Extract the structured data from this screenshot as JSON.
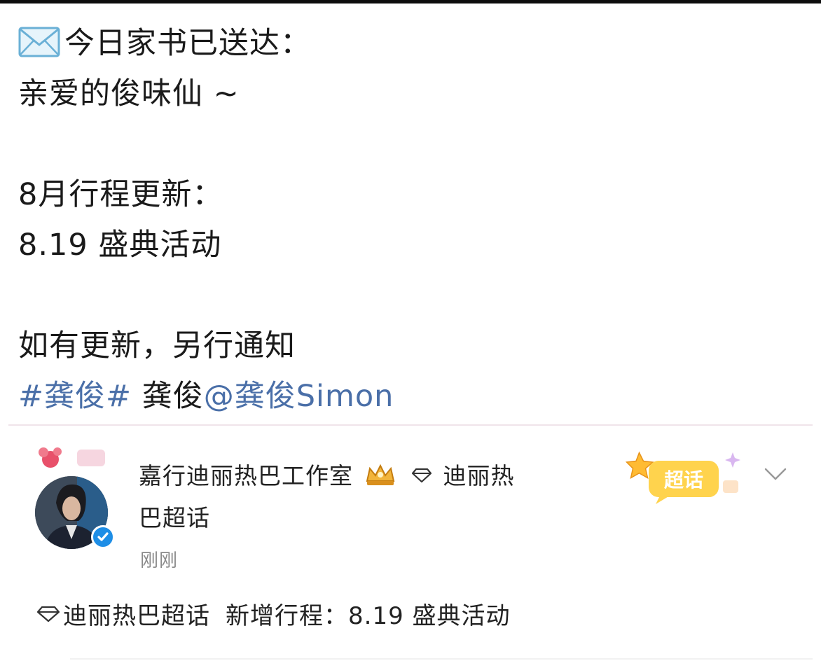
{
  "post": {
    "line1": "今日家书已送达：",
    "line2": "亲爱的俊味仙 ~",
    "line3": "8月行程更新：",
    "line4": "8.19 盛典活动",
    "line5": "如有更新，另行通知",
    "hashtag": "#龚俊#",
    "plain_name": " 龚俊",
    "mention": "@龚俊Simon"
  },
  "header": {
    "name": "嘉行迪丽热巴工作室",
    "topic_part1": "迪丽热",
    "topic_part2": "巴超话",
    "timestamp": "刚刚",
    "badge_label": "超话"
  },
  "footer": {
    "topic": "迪丽热巴超话",
    "update": "新增行程：8.19 盛典活动"
  },
  "icons": {
    "envelope": "envelope-icon",
    "crown": "crown-icon",
    "diamond": "diamond-icon",
    "verified": "verified-icon",
    "chevron": "chevron-down-icon"
  },
  "colors": {
    "link": "#4a6fa8",
    "verified": "#1e8ee6",
    "badge": "#ffd34d"
  }
}
